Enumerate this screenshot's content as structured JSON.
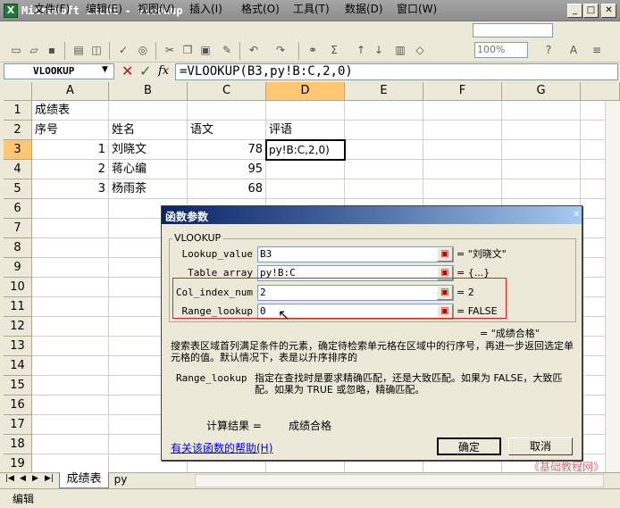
{
  "window": {
    "title": "Microsoft Excel - vlookup",
    "app_icon_letter": "X"
  },
  "window_controls": {
    "minimize": "_",
    "restore": "□",
    "close": "✕"
  },
  "menu": {
    "items": [
      "文件(F)",
      "编辑(E)",
      "视图(V)",
      "插入(I)",
      "格式(O)",
      "工具(T)",
      "数据(D)",
      "窗口(W)"
    ],
    "help_search_placeholder": ""
  },
  "toolbar": {
    "zoom": "100%"
  },
  "formula_bar": {
    "name_box": "VLOOKUP",
    "cancel": "✕",
    "enter": "✓",
    "fx": "fx",
    "formula": "=VLOOKUP(B3,py!B:C,2,0)"
  },
  "grid": {
    "columns": [
      "A",
      "B",
      "C",
      "D",
      "E",
      "F",
      "G"
    ],
    "selected_column": "D",
    "rows": [
      "1",
      "2",
      "3",
      "4",
      "5",
      "6",
      "7",
      "8",
      "9",
      "10",
      "11",
      "12",
      "13",
      "14",
      "15",
      "16",
      "17",
      "18",
      "19"
    ],
    "selected_row": "3",
    "cells": {
      "A1": "成绩表",
      "A2": "序号",
      "B2": "姓名",
      "C2": "语文",
      "D2": "评语",
      "A3": "1",
      "B3": "刘晓文",
      "C3": "78",
      "D3": "py!B:C,2,0)",
      "A4": "2",
      "B4": "蒋心编",
      "C4": "95",
      "A5": "3",
      "B5": "杨雨茶",
      "C5": "68"
    }
  },
  "sheet_tabs": {
    "tabs": [
      "成绩表",
      "py"
    ],
    "active": "成绩表"
  },
  "status_bar": {
    "text": "编辑"
  },
  "watermark": "《基础教程网》",
  "dialog": {
    "title": "函数参数",
    "function_name": "VLOOKUP",
    "args": [
      {
        "label": "Lookup_value",
        "value": "B3",
        "result": "= \"刘晓文\""
      },
      {
        "label": "Table_array",
        "value": "py!B:C",
        "result": "= {...}"
      },
      {
        "label": "Col_index_num",
        "value": "2",
        "result": "= 2"
      },
      {
        "label": "Range_lookup",
        "value": "0",
        "result": "= FALSE"
      }
    ],
    "overall_result": "= \"成绩合格\"",
    "description": "搜索表区域首列满足条件的元素，确定待检索单元格在区域中的行序号，再进一步返回选定单元格的值。默认情况下，表是以升序排序的",
    "param_name": "Range_lookup",
    "param_help": "指定在查找时是要求精确匹配，还是大致匹配。如果为 FALSE，大致匹配。如果为 TRUE 或忽略，精确匹配。",
    "calc_label": "计算结果 =",
    "calc_value": "成绩合格",
    "help_link": "有关该函数的帮助(H)",
    "ok": "确定",
    "cancel": "取消"
  }
}
